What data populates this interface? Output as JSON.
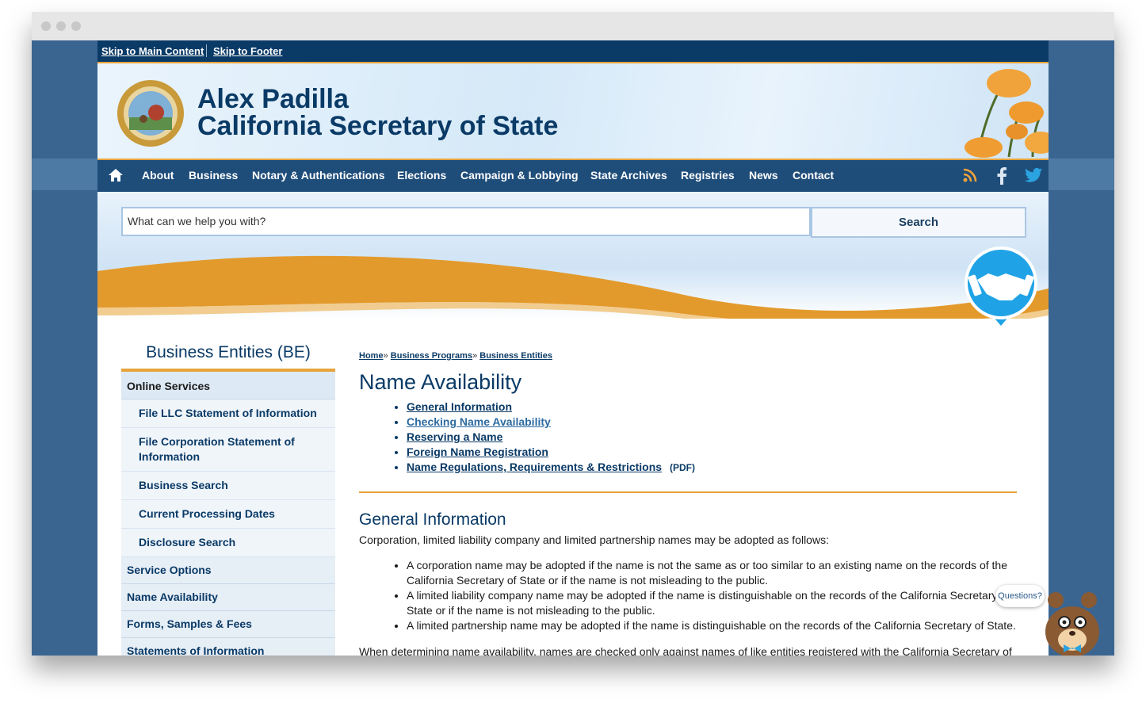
{
  "skip_links": [
    "Skip to Main Content",
    "Skip to Footer"
  ],
  "header": {
    "title_line1": "Alex Padilla",
    "title_line2": "California Secretary of State"
  },
  "nav": {
    "items": [
      "About",
      "Business",
      "Notary & Authentications",
      "Elections",
      "Campaign & Lobbying",
      "State Archives",
      "Registries",
      "News",
      "Contact"
    ]
  },
  "search": {
    "placeholder": "What can we help you with?",
    "button_label": "Search"
  },
  "sidebar": {
    "title": "Business Entities (BE)",
    "section_label": "Online Services",
    "sub_items": [
      "File LLC Statement of Information",
      "File Corporation Statement of Information",
      "Business Search",
      "Current Processing Dates",
      "Disclosure Search"
    ],
    "items": [
      "Service Options",
      "Name Availability",
      "Forms, Samples & Fees",
      "Statements of Information (annual/biennial reports)"
    ]
  },
  "breadcrumb": [
    "Home",
    "Business Programs",
    "Business Entities"
  ],
  "main": {
    "page_title": "Name Availability",
    "toc": [
      "General Information",
      "Checking Name Availability",
      "Reserving a Name",
      "Foreign Name Registration",
      "Name Regulations, Requirements & Restrictions"
    ],
    "pdf_label": "(PDF)",
    "section_title": "General Information",
    "intro": "Corporation, limited liability company and limited partnership names may be adopted as follows:",
    "bullets": [
      "A corporation name may be adopted if the name is not the same as or too similar to an existing name on the records of the California Secretary of State or if the name is not misleading to the public.",
      "A limited liability company name may be adopted if the name is distinguishable on the records of the California Secretary of State or if the name is not misleading to the public.",
      "A limited partnership name may be adopted if the name is distinguishable on the records of the California Secretary of State."
    ],
    "closing": "When determining name availability, names are checked only against names of like entities registered with the California Secretary of"
  },
  "chat": {
    "bubble_label": "Questions?"
  },
  "colors": {
    "navy": "#0a3a66",
    "accent": "#e8a33a",
    "nav_bg": "#1f4d7a",
    "frame_bg": "#3a6591"
  },
  "icons": [
    "home-icon",
    "rss-icon",
    "facebook-icon",
    "twitter-icon",
    "handshake-icon",
    "state-seal-logo",
    "poppy-flowers-image",
    "bear-mascot-icon"
  ]
}
